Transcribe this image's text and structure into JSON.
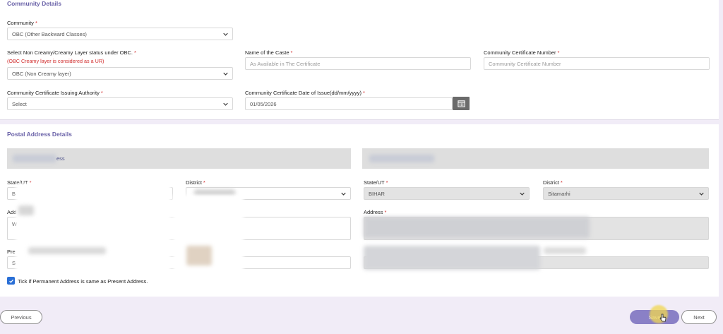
{
  "community": {
    "section_title": "Community Details",
    "community": {
      "label": "Community",
      "value": "OBC (Other Backward Classes)"
    },
    "creamy": {
      "label": "Select Non Creamy/Creamy Layer status under OBC.",
      "note": "(OBC Creamy layer is considered as a UR)",
      "value": "OBC (Non Creamy layer)"
    },
    "caste": {
      "label": "Name of the Caste",
      "placeholder": "As Available in The Certificate"
    },
    "cert_number": {
      "label": "Community Certificate Number",
      "placeholder": "Community Certificate Number"
    },
    "authority": {
      "label": "Community Certificate Issuing Authority",
      "value": "Select"
    },
    "issue_date": {
      "label": "Community Certificate Date of Issue(dd/mm/yyyy)",
      "value": "01/05/2026"
    }
  },
  "postal": {
    "section_title": "Postal Address Details",
    "present": {
      "header_fragment": "ess",
      "state_label": "State/UT",
      "state_value": "B",
      "district_label": "District",
      "address_label": "Add",
      "address_value": "W",
      "pincode_label": "Pre",
      "pincode_value": "S"
    },
    "permanent": {
      "state_label": "State/UT",
      "state_value": "BIHAR",
      "district_label": "District",
      "district_value": "Sitamarhi",
      "address_label": "Address"
    },
    "same_address_label": "Tick if Permanent Address is same as Present Address."
  },
  "footer": {
    "previous_label": "Previous",
    "save_label": "Save",
    "next_label": "Next"
  },
  "colors": {
    "accent": "#6a62a8",
    "required": "#d12e2e",
    "save_button": "#8a80c6",
    "checkbox": "#2a6fd6",
    "page_background": "#f1ecf7"
  }
}
